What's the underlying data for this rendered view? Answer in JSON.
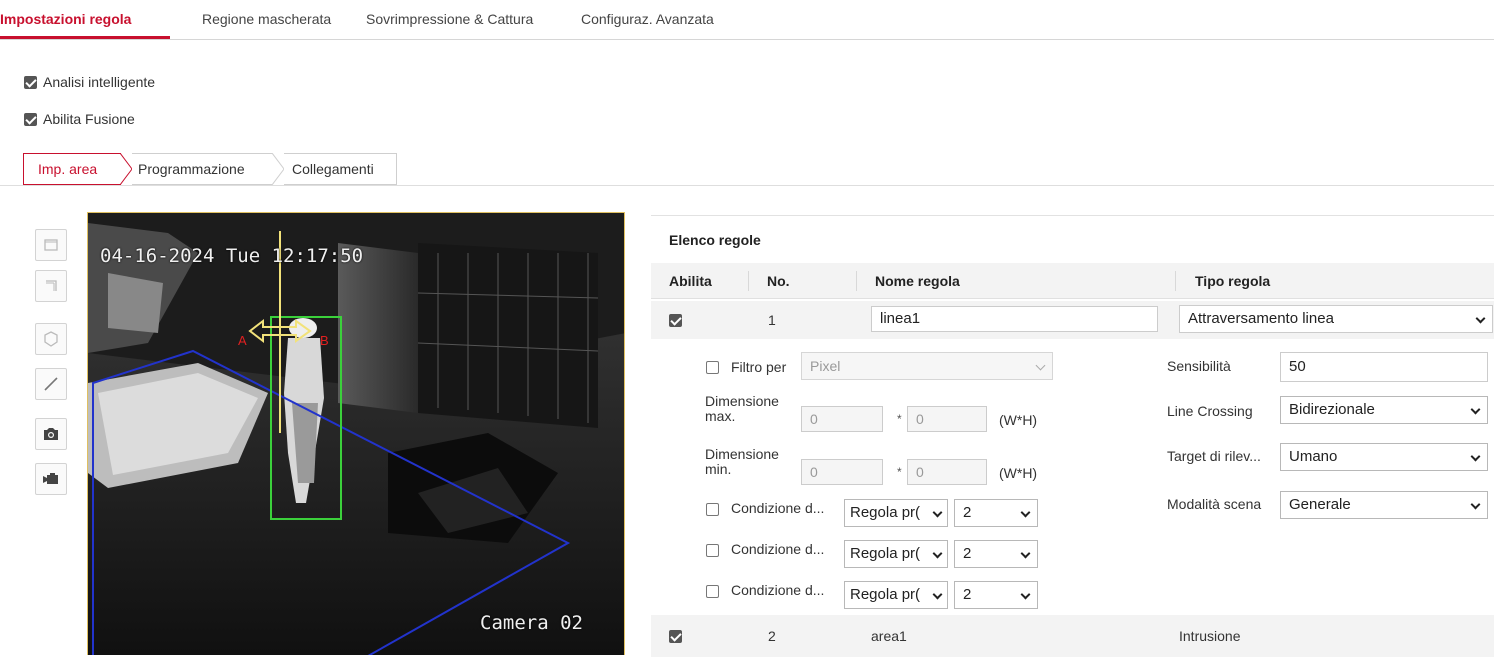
{
  "top_tabs": [
    {
      "label": "Impostazioni regola",
      "active": true
    },
    {
      "label": "Regione mascherata",
      "active": false
    },
    {
      "label": "Sovrimpressione & Cattura",
      "active": false
    },
    {
      "label": "Configuraz. Avanzata",
      "active": false
    }
  ],
  "options": {
    "smart_analysis": {
      "label": "Analisi intelligente",
      "checked": true
    },
    "enable_fusion": {
      "label": "Abilita Fusione",
      "checked": true
    }
  },
  "sub_tabs": [
    {
      "label": "Imp. area",
      "active": true
    },
    {
      "label": "Programmazione",
      "active": false
    },
    {
      "label": "Collegamenti",
      "active": false
    }
  ],
  "toolbar": {
    "icons": [
      "rectangle-icon",
      "polygon-corner-icon",
      "polygon-icon",
      "line-icon",
      "camera-icon",
      "video-record-icon"
    ]
  },
  "video": {
    "timestamp": "04-16-2024 Tue 12:17:50",
    "camera_name": "Camera 02",
    "line_labels": {
      "a": "A",
      "b": "B"
    },
    "colors": {
      "line": "#f2e27a",
      "target_box": "#3bd13b",
      "area": "#2233cc",
      "labels": "#e02020"
    }
  },
  "rules": {
    "title": "Elenco regole",
    "columns": {
      "enable": "Abilita",
      "no": "No.",
      "name": "Nome regola",
      "type": "Tipo regola"
    },
    "rows": [
      {
        "enabled": true,
        "no": "1",
        "name": "linea1",
        "type": "Attraversamento linea"
      },
      {
        "enabled": true,
        "no": "2",
        "name": "area1",
        "type": "Intrusione"
      }
    ]
  },
  "detail": {
    "filter": {
      "label": "Filtro per",
      "checked": false,
      "value": "Pixel"
    },
    "max_size": {
      "label": "Dimensione max.",
      "w": "0",
      "h": "0",
      "unit": "(W*H)"
    },
    "min_size": {
      "label": "Dimensione min.",
      "w": "0",
      "h": "0",
      "unit": "(W*H)"
    },
    "conditions": [
      {
        "label": "Condizione d...",
        "checked": false,
        "rule": "Regola pr(",
        "value": "2"
      },
      {
        "label": "Condizione d...",
        "checked": false,
        "rule": "Regola pr(",
        "value": "2"
      },
      {
        "label": "Condizione d...",
        "checked": false,
        "rule": "Regola pr(",
        "value": "2"
      }
    ],
    "sensitivity": {
      "label": "Sensibilità",
      "value": "50"
    },
    "line_crossing": {
      "label": "Line Crossing",
      "value": "Bidirezionale"
    },
    "target": {
      "label": "Target di rilev...",
      "value": "Umano"
    },
    "scene_mode": {
      "label": "Modalità scena",
      "value": "Generale"
    }
  },
  "colors": {
    "accent": "#c8102e"
  }
}
